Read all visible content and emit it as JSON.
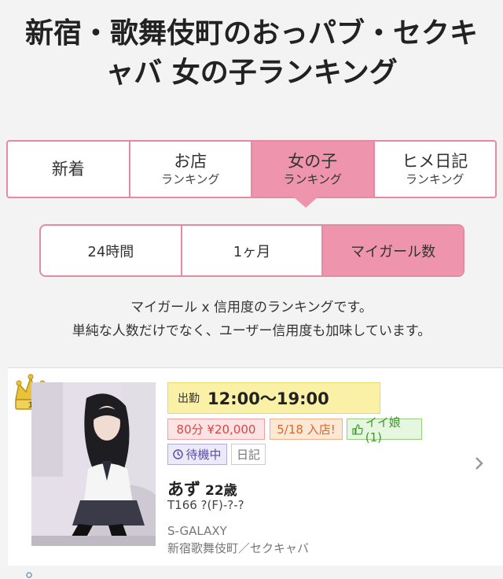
{
  "page_title": "新宿・歌舞伎町のおっパブ・セクキャバ 女の子ランキング",
  "tabs": [
    {
      "main": "新着",
      "sub": ""
    },
    {
      "main": "お店",
      "sub": "ランキング"
    },
    {
      "main": "女の子",
      "sub": "ランキング"
    },
    {
      "main": "ヒメ日記",
      "sub": "ランキング"
    }
  ],
  "active_tab": "女の子",
  "period_options": [
    "24時間",
    "1ヶ月",
    "マイガール数"
  ],
  "active_period": "マイガール数",
  "description_lines": [
    "マイガール x 信用度のランキングです。",
    "単純な人数だけでなく、ユーザー信用度も加味しています。"
  ],
  "ranking": [
    {
      "rank": "1",
      "shift_label": "出勤",
      "shift_time": "12:00〜19:00",
      "price": "80分 ¥20,000",
      "new_label": "5/18 入店!",
      "good_label": "イイ娘(1)",
      "status": "待機中",
      "diary": "日記",
      "name": "あず",
      "age": "22歳",
      "size": "T166 ?(F)-?-?",
      "shop": "S-GALAXY",
      "area": "新宿歌舞伎町／セクキャバ"
    }
  ],
  "colors": {
    "accent": "#ef94ad",
    "border": "#e58aa1",
    "shift_bg": "#fbf1a6"
  }
}
